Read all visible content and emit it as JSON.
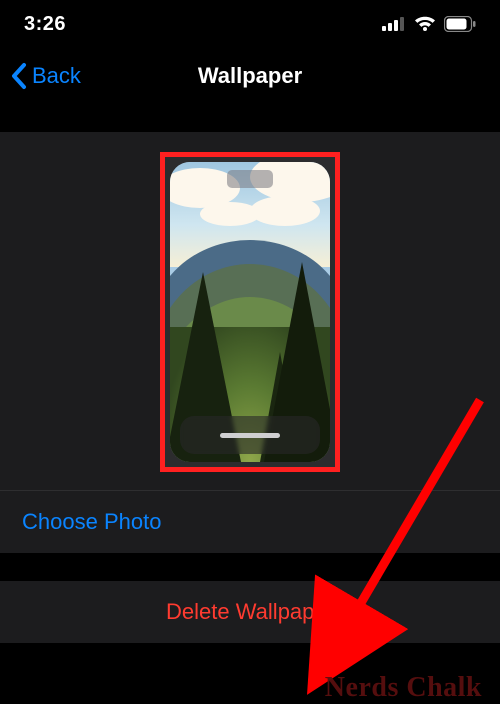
{
  "status": {
    "time": "3:26"
  },
  "nav": {
    "back_label": "Back",
    "title": "Wallpaper"
  },
  "wallpaper": {
    "choose_photo_label": "Choose Photo",
    "delete_label": "Delete Wallpaper"
  },
  "watermark": {
    "text": "Nerds Chalk"
  },
  "icons": {
    "signal": "signal-icon",
    "wifi": "wifi-icon",
    "battery": "battery-icon",
    "chevron_left": "chevron-left-icon"
  },
  "colors": {
    "accent_blue": "#0a84ff",
    "destructive_red": "#ff3b30",
    "annotation_red": "#ff0000"
  }
}
